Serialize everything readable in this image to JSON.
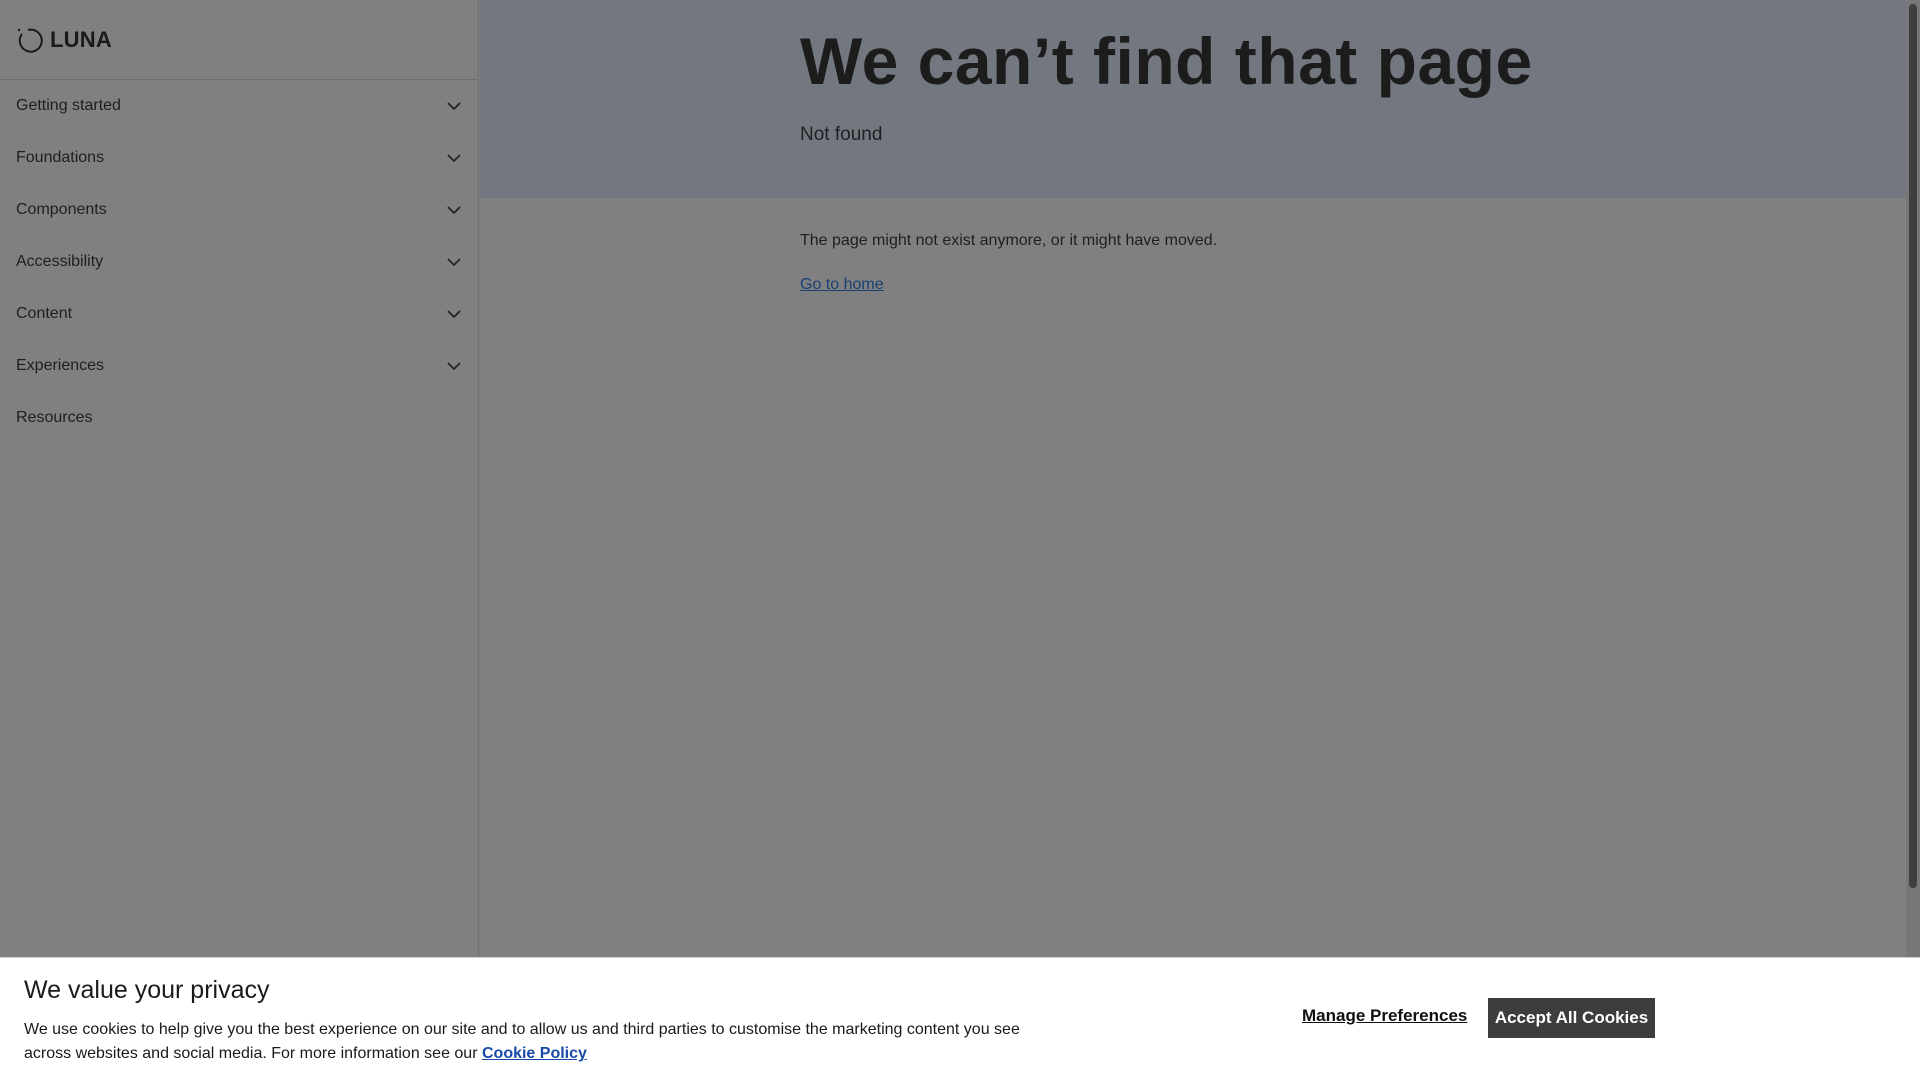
{
  "brand": {
    "name": "LUNA",
    "logo_icon": "ring-logo-icon"
  },
  "sidebar": {
    "items": [
      {
        "label": "Getting started",
        "expandable": true
      },
      {
        "label": "Foundations",
        "expandable": true
      },
      {
        "label": "Components",
        "expandable": true
      },
      {
        "label": "Accessibility",
        "expandable": true
      },
      {
        "label": "Content",
        "expandable": true
      },
      {
        "label": "Experiences",
        "expandable": true
      },
      {
        "label": "Resources",
        "expandable": false
      }
    ]
  },
  "main": {
    "title": "We can’t find that page",
    "subtitle": "Not found",
    "message": "The page might not exist anymore, or it might have moved.",
    "home_link": "Go to home"
  },
  "cookie_banner": {
    "title": "We value your privacy",
    "message": "We use cookies to help give you the best experience on our site and to allow us and third parties to customise the marketing content you see across websites and social media. For more information see our",
    "policy_link": "Cookie Policy",
    "manage_label": "Manage Preferences",
    "accept_label": "Accept All Cookies"
  },
  "colors": {
    "overlay": "#808080",
    "hero_bg": "#727780",
    "link": "#1a3f73",
    "accept_button": "#3d3d3d"
  }
}
